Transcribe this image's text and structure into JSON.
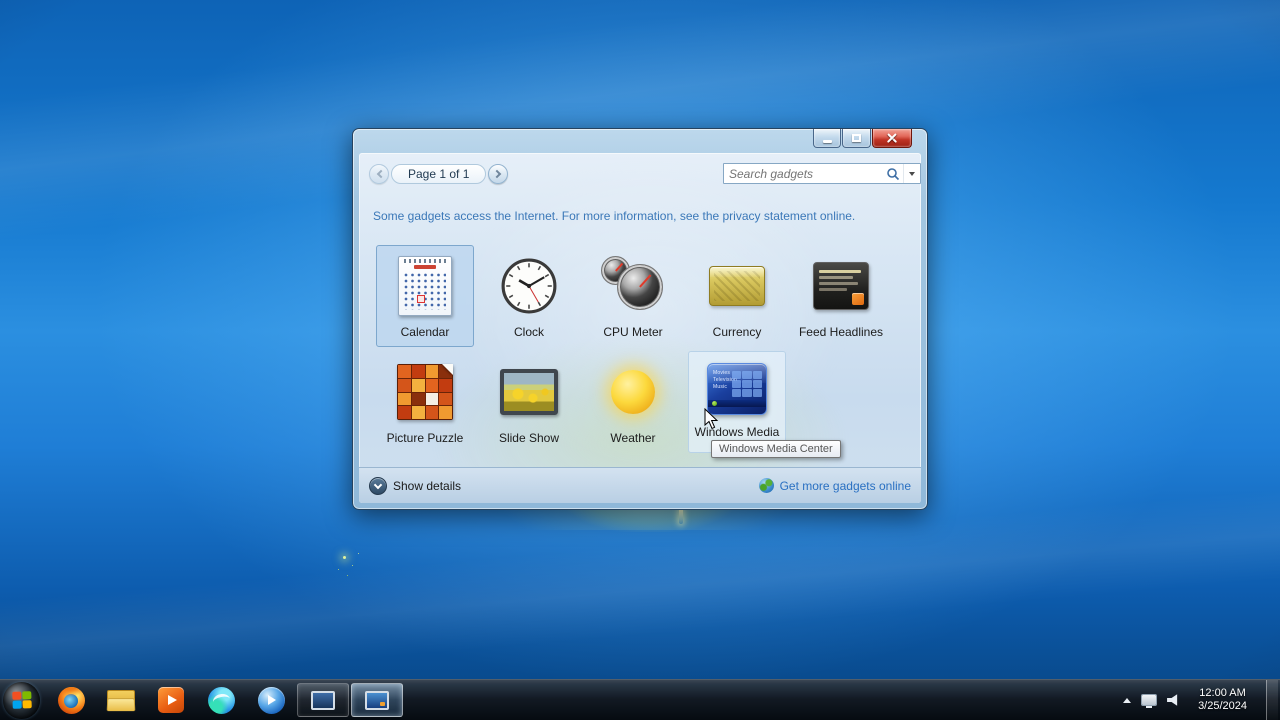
{
  "gadget_gallery": {
    "nav": {
      "page_label": "Page 1 of 1"
    },
    "search": {
      "placeholder": "Search gadgets"
    },
    "info_text": "Some gadgets access the Internet.  For more information, see the privacy statement online.",
    "gadgets": [
      {
        "name": "Calendar",
        "selected": true
      },
      {
        "name": "Clock"
      },
      {
        "name": "CPU Meter"
      },
      {
        "name": "Currency"
      },
      {
        "name": "Feed Headlines"
      },
      {
        "name": "Picture Puzzle"
      },
      {
        "name": "Slide Show"
      },
      {
        "name": "Weather"
      },
      {
        "name": "Windows Media Center",
        "hovered": true
      }
    ],
    "wmc_menu": [
      "Movies",
      "Television",
      "Music"
    ],
    "tooltip": "Windows Media Center",
    "footer": {
      "show_details": "Show details",
      "get_more_link": "Get more gadgets online"
    }
  },
  "taskbar": {
    "clock": {
      "time": "12:00 AM",
      "date": "3/25/2024"
    }
  },
  "colors": {
    "link_blue": "#2a70c2",
    "info_text_blue": "#3b78b8",
    "selection_border": "#7da7cd",
    "close_button_red": "#c03425",
    "taskbar_bg": "#0a1016"
  }
}
